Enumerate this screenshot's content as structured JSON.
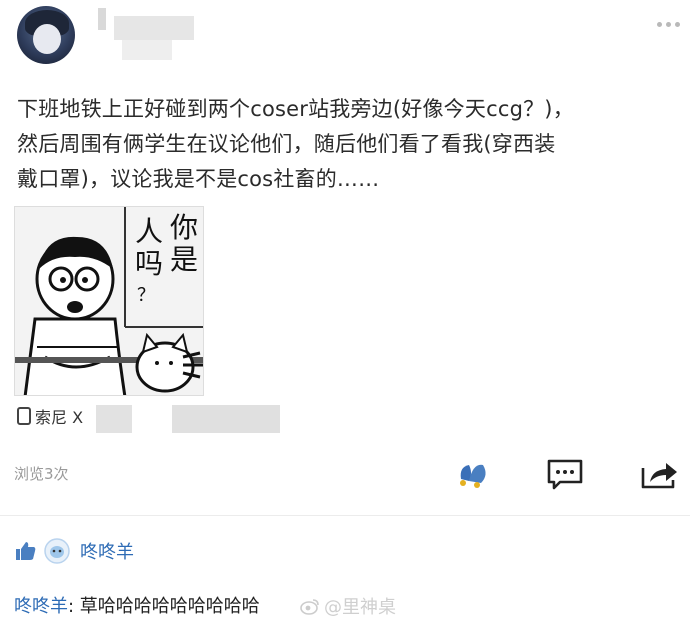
{
  "post": {
    "text": "下班地铁上正好碰到两个coser站我旁边(好像今天ccg？)，\n然后周围有俩学生在议论他们，随后他们看了看我(穿西装\n戴口罩)，议论我是不是cos社畜的……"
  },
  "image": {
    "speech_bubble": [
      "你",
      "是",
      "人",
      "吗"
    ],
    "question_mark": "？"
  },
  "device": {
    "label": "索尼 X"
  },
  "stats": {
    "views": "浏览3次"
  },
  "likes": {
    "name": "咚咚羊"
  },
  "comment": {
    "author": "咚咚羊",
    "separator": ": ",
    "text": "草哈哈哈哈哈哈哈哈哈"
  },
  "watermark": {
    "text": "@里神桌"
  },
  "colors": {
    "link": "#2d6bb5",
    "muted": "#9a9a9a",
    "like_blue": "#4a7fc1"
  }
}
